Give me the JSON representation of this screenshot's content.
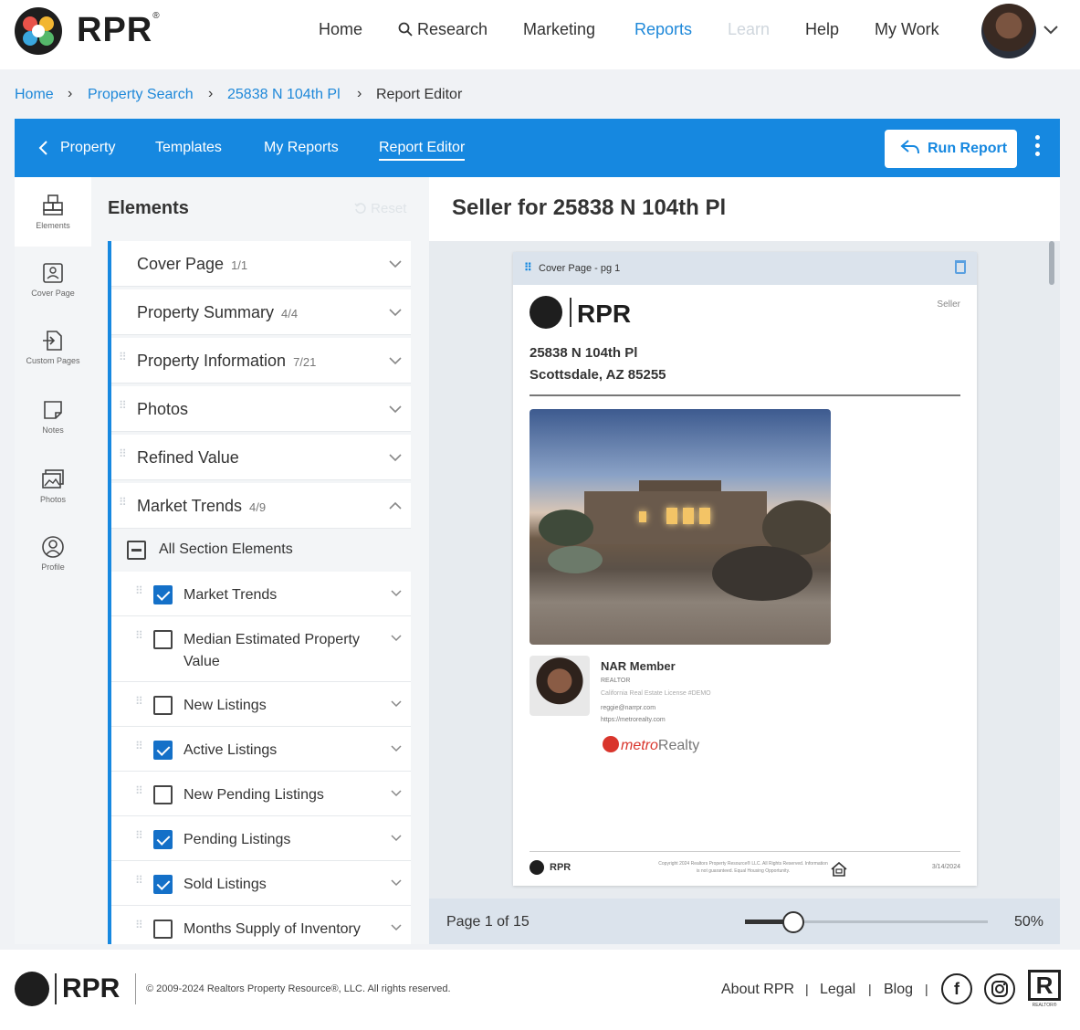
{
  "app": {
    "logo_text": "RPR",
    "logo_reg": "®"
  },
  "nav": {
    "items": [
      {
        "label": "Home"
      },
      {
        "label": "Research"
      },
      {
        "label": "Marketing"
      },
      {
        "label": "Reports"
      },
      {
        "label": "Learn"
      },
      {
        "label": "Help"
      },
      {
        "label": "My Work"
      }
    ],
    "active": "Reports",
    "chevron": "⌄"
  },
  "breadcrumb": {
    "items": [
      "Home",
      "Property Search",
      "25838 N 104th Pl",
      "Report Editor"
    ],
    "separator": "›"
  },
  "toolbar": {
    "back_label": "Property",
    "tabs": [
      "Templates",
      "My Reports",
      "Report Editor"
    ],
    "run_label": "Run Report",
    "brand_color": "#1688e0"
  },
  "rail": {
    "items": [
      {
        "label": "Elements",
        "icon": "boxes-icon"
      },
      {
        "label": "Cover Page",
        "icon": "cover-page-icon"
      },
      {
        "label": "Custom Pages",
        "icon": "custom-pages-icon"
      },
      {
        "label": "Notes",
        "icon": "notes-icon"
      },
      {
        "label": "Photos",
        "icon": "photos-icon"
      },
      {
        "label": "Profile",
        "icon": "profile-icon"
      }
    ]
  },
  "elements": {
    "title": "Elements",
    "reset_label": "Reset",
    "sections": [
      {
        "name": "Cover Page",
        "count": "1/1"
      },
      {
        "name": "Property Summary",
        "count": "4/4"
      },
      {
        "name": "Property Information",
        "count": "7/21"
      },
      {
        "name": "Photos",
        "count": ""
      },
      {
        "name": "Refined Value",
        "count": ""
      },
      {
        "name": "Market Trends",
        "count": "4/9"
      }
    ],
    "all_label": "All Section Elements",
    "sub_items": [
      {
        "name": "Market Trends",
        "checked": true
      },
      {
        "name": "Median Estimated Property Value",
        "checked": false
      },
      {
        "name": "New Listings",
        "checked": false
      },
      {
        "name": "Active Listings",
        "checked": true
      },
      {
        "name": "New Pending Listings",
        "checked": false
      },
      {
        "name": "Pending Listings",
        "checked": true
      },
      {
        "name": "Sold Listings",
        "checked": true
      },
      {
        "name": "Months Supply of Inventory",
        "checked": false
      }
    ]
  },
  "preview": {
    "title": "Seller for 25838 N 104th Pl",
    "card_label": "Cover Page - pg 1",
    "doc": {
      "logo_text": "RPR",
      "seller_tag": "Seller",
      "address_line1": "25838 N 104th Pl",
      "address_line2": "Scottsdale, AZ 85255",
      "agent_name": "NAR Member",
      "agent_title": "REALTOR",
      "agent_license": "California Real Estate License #DEMO",
      "agent_email": "reggie@narrpr.com",
      "agent_web": "https://metrorealty.com",
      "brokerage_a": "metro",
      "brokerage_b": "Realty",
      "footer_logo": "RPR",
      "footer_copy": "Copyright 2024 Realtors Property Resource® LLC. All Rights Reserved. Information is not guaranteed. Equal Housing Opportunity.",
      "footer_date": "3/14/2024"
    },
    "page_label": "Page 1 of 15",
    "zoom_label": "50%",
    "zoom_fraction": 0.2
  },
  "footer": {
    "logo_text": "RPR",
    "copyright": "© 2009-2024 Realtors Property Resource®, LLC. All rights reserved.",
    "links": [
      "About RPR",
      "Legal",
      "Blog"
    ],
    "pipe": "|",
    "social": [
      "facebook-icon",
      "instagram-icon"
    ],
    "realtor_mark": "R",
    "realtor_sub": "REALTOR®"
  }
}
